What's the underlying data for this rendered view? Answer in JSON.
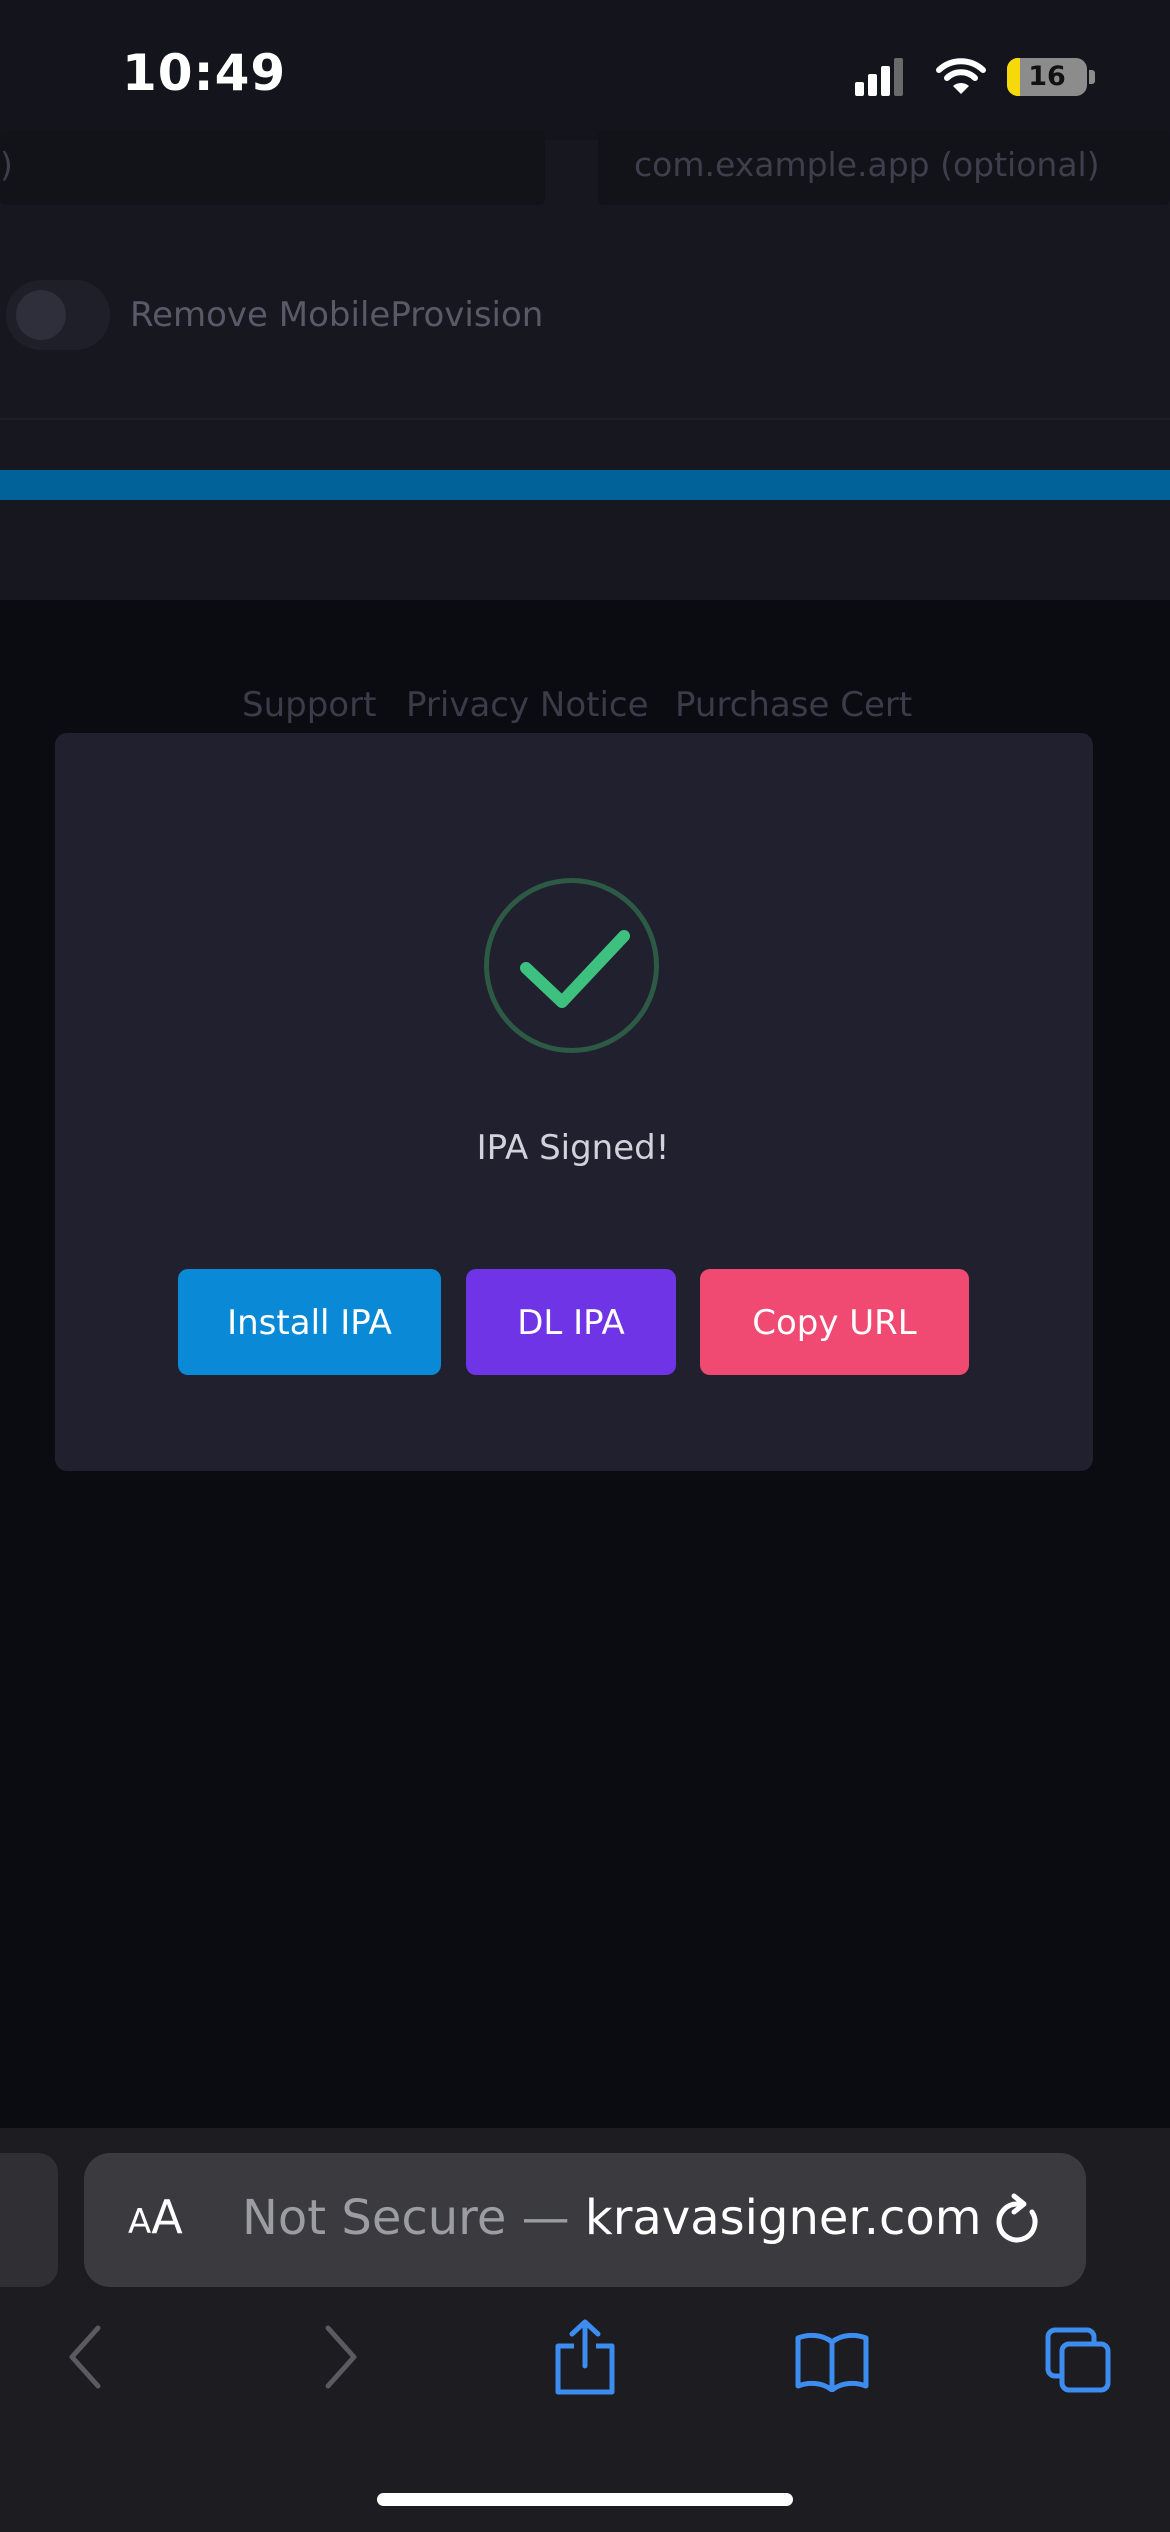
{
  "status_bar": {
    "time": "10:49",
    "battery": "16",
    "battery_level": 0.16
  },
  "form": {
    "left_input_fragment": ")",
    "bundle_id_placeholder": "com.example.app (optional)",
    "remove_mobileprovision_label": "Remove MobileProvision",
    "progress": 1.0
  },
  "footer": {
    "links": [
      "Support",
      "Privacy Notice",
      "Purchase Cert"
    ]
  },
  "modal": {
    "title": "IPA Signed!",
    "buttons": {
      "install": "Install IPA",
      "download": "DL IPA",
      "copy": "Copy URL"
    },
    "colors": {
      "install": "#0a8ad6",
      "download": "#6e34e6",
      "copy": "#f04a72",
      "check": "#3ec07f"
    }
  },
  "safari": {
    "aa_small": "A",
    "aa_large": "A",
    "url_prefix": "Not Secure — ",
    "url_domain": "kravasigner.com"
  }
}
